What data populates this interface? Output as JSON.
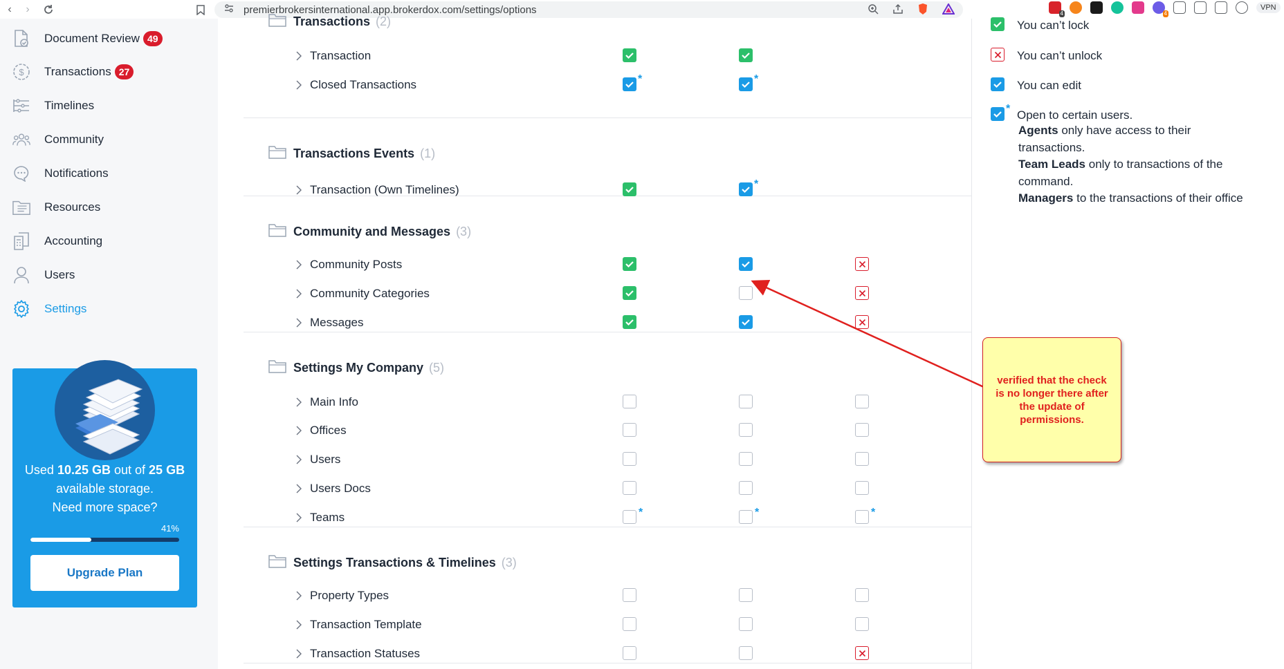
{
  "browser": {
    "url": "premierbrokersinternational.app.brokerdox.com/settings/options",
    "vpn_label": "VPN"
  },
  "sidebar": {
    "items": [
      {
        "label": "Document Review",
        "badge": "49",
        "icon": "document-review-icon"
      },
      {
        "label": "Transactions",
        "badge": "27",
        "icon": "dollar-cycle-icon"
      },
      {
        "label": "Timelines",
        "icon": "timelines-icon"
      },
      {
        "label": "Community",
        "icon": "community-icon"
      },
      {
        "label": "Notifications",
        "icon": "chat-bubble-icon"
      },
      {
        "label": "Resources",
        "icon": "folder-icon"
      },
      {
        "label": "Accounting",
        "icon": "calculator-icon"
      },
      {
        "label": "Users",
        "icon": "user-icon"
      },
      {
        "label": "Settings",
        "icon": "gear-icon",
        "active": true
      }
    ],
    "storage": {
      "used_prefix": "Used ",
      "used": "10.25 GB",
      "middle": " out of ",
      "total": "25 GB",
      "suffix": " available storage.",
      "question": "Need more space?",
      "percent_label": "41%",
      "percent": 41,
      "upgrade_label": "Upgrade Plan"
    }
  },
  "sections": [
    {
      "title": "Transactions",
      "count": "(2)",
      "rows": [
        {
          "label": "Transaction",
          "cells": [
            "green",
            "green",
            "none"
          ]
        },
        {
          "label": "Closed Transactions",
          "cells": [
            "blue*",
            "blue*",
            "none"
          ]
        }
      ]
    },
    {
      "title": "Transactions Events",
      "count": "(1)",
      "rows": [
        {
          "label": "Transaction (Own Timelines)",
          "cells": [
            "green",
            "blue*",
            "none"
          ]
        }
      ]
    },
    {
      "title": "Community and Messages",
      "count": "(3)",
      "rows": [
        {
          "label": "Community Posts",
          "cells": [
            "green",
            "blue",
            "redx"
          ]
        },
        {
          "label": "Community Categories",
          "cells": [
            "green",
            "empty",
            "redx"
          ]
        },
        {
          "label": "Messages",
          "cells": [
            "green",
            "blue",
            "redx"
          ]
        }
      ]
    },
    {
      "title": "Settings My Company",
      "count": "(5)",
      "rows": [
        {
          "label": "Main Info",
          "cells": [
            "empty",
            "empty",
            "empty"
          ]
        },
        {
          "label": "Offices",
          "cells": [
            "empty",
            "empty",
            "empty"
          ]
        },
        {
          "label": "Users",
          "cells": [
            "empty",
            "empty",
            "empty"
          ]
        },
        {
          "label": "Users Docs",
          "cells": [
            "empty",
            "empty",
            "empty"
          ]
        },
        {
          "label": "Teams",
          "cells": [
            "empty*",
            "empty*",
            "empty*"
          ]
        }
      ]
    },
    {
      "title": "Settings Transactions & Timelines",
      "count": "(3)",
      "rows": [
        {
          "label": "Property Types",
          "cells": [
            "empty",
            "empty",
            "empty"
          ]
        },
        {
          "label": "Transaction Template",
          "cells": [
            "empty",
            "empty",
            "empty"
          ]
        },
        {
          "label": "Transaction Statuses",
          "cells": [
            "empty",
            "empty",
            "redx"
          ]
        }
      ]
    }
  ],
  "legend": {
    "cant_lock": "You can’t lock",
    "cant_unlock": "You can’t unlock",
    "can_edit": "You can edit",
    "open_intro": "Open to certain users.",
    "agents_b": "Agents",
    "agents_t": " only have access to their transactions.",
    "leads_b": "Team Leads",
    "leads_t": " only to transactions of the command.",
    "managers_b": "Managers",
    "managers_t": " to the transactions of their office"
  },
  "annotation": {
    "text": "verified that the check is no longer there after the update of permissions."
  },
  "colors": {
    "accent": "#1a9be6",
    "green": "#2cbf6a",
    "red": "#d91c2c",
    "note_bg": "#ffffaa"
  }
}
